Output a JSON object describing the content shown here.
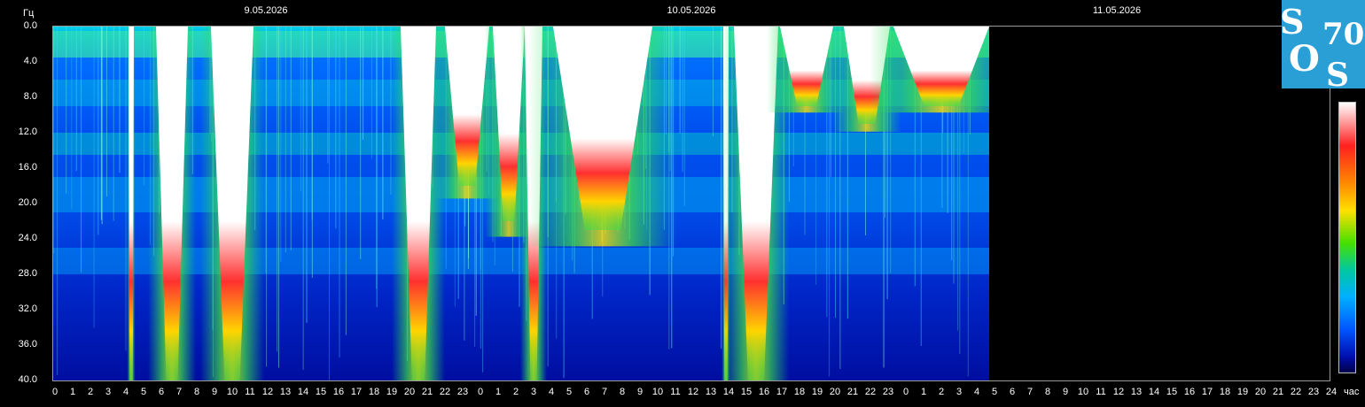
{
  "chart_data": {
    "type": "heatmap",
    "ylabel": "Гц",
    "xlabel": "час",
    "y_ticks": [
      "0.0",
      "4.0",
      "8.0",
      "12.0",
      "16.0",
      "20.0",
      "24.0",
      "28.0",
      "32.0",
      "36.0",
      "40.0"
    ],
    "ylim": [
      0,
      40
    ],
    "x_ticks": [
      "0",
      "1",
      "2",
      "3",
      "4",
      "5",
      "6",
      "7",
      "8",
      "9",
      "10",
      "11",
      "12",
      "13",
      "14",
      "15",
      "16",
      "17",
      "18",
      "19",
      "20",
      "21",
      "22",
      "23",
      "0",
      "1",
      "2",
      "3",
      "4",
      "5",
      "6",
      "7",
      "8",
      "9",
      "10",
      "11",
      "12",
      "13",
      "14",
      "15",
      "16",
      "17",
      "18",
      "19",
      "20",
      "21",
      "22",
      "23",
      "0",
      "1",
      "2",
      "3",
      "4",
      "5",
      "6",
      "7",
      "8",
      "9",
      "10",
      "11",
      "12",
      "13",
      "14",
      "15",
      "16",
      "17",
      "18",
      "19",
      "20",
      "21",
      "22",
      "23",
      "24"
    ],
    "dates": [
      "9.05.2026",
      "10.05.2026",
      "11.05.2026"
    ],
    "data_end_hour": 52.8,
    "background_bands_hz": [
      [
        0.5,
        3.5
      ],
      [
        6,
        9
      ],
      [
        12,
        14.5
      ],
      [
        17,
        21
      ],
      [
        25,
        28
      ]
    ],
    "bursts": [
      {
        "start_hour": 4.25,
        "end_hour": 4.55,
        "max_hz": 40
      },
      {
        "start_hour": 5.8,
        "end_hour": 7.6,
        "max_hz": 40
      },
      {
        "start_hour": 8.9,
        "end_hour": 11.3,
        "max_hz": 40
      },
      {
        "start_hour": 19.6,
        "end_hour": 21.6,
        "max_hz": 40
      },
      {
        "start_hour": 22.1,
        "end_hour": 24.6,
        "max_hz": 18
      },
      {
        "start_hour": 24.8,
        "end_hour": 26.6,
        "max_hz": 22
      },
      {
        "start_hour": 26.6,
        "end_hour": 27.6,
        "max_hz": 40
      },
      {
        "start_hour": 28.2,
        "end_hour": 33.8,
        "max_hz": 23
      },
      {
        "start_hour": 37.8,
        "end_hour": 38.1,
        "max_hz": 40
      },
      {
        "start_hour": 38.4,
        "end_hour": 40.9,
        "max_hz": 40
      },
      {
        "start_hour": 41.0,
        "end_hour": 44.0,
        "max_hz": 9
      },
      {
        "start_hour": 44.6,
        "end_hour": 47.2,
        "max_hz": 11
      },
      {
        "start_hour": 47.4,
        "end_hour": 52.8,
        "max_hz": 9
      }
    ],
    "colorbar": [
      "#ffffff",
      "#ff2020",
      "#ff8a00",
      "#ffe000",
      "#46e000",
      "#00c8a0",
      "#00b0ff",
      "#0055ff",
      "#0010b0",
      "#00004a"
    ]
  },
  "logo": {
    "s1": "S",
    "o": "O",
    "s2": "S",
    "num": "70",
    "color": "#2a9fd6"
  }
}
